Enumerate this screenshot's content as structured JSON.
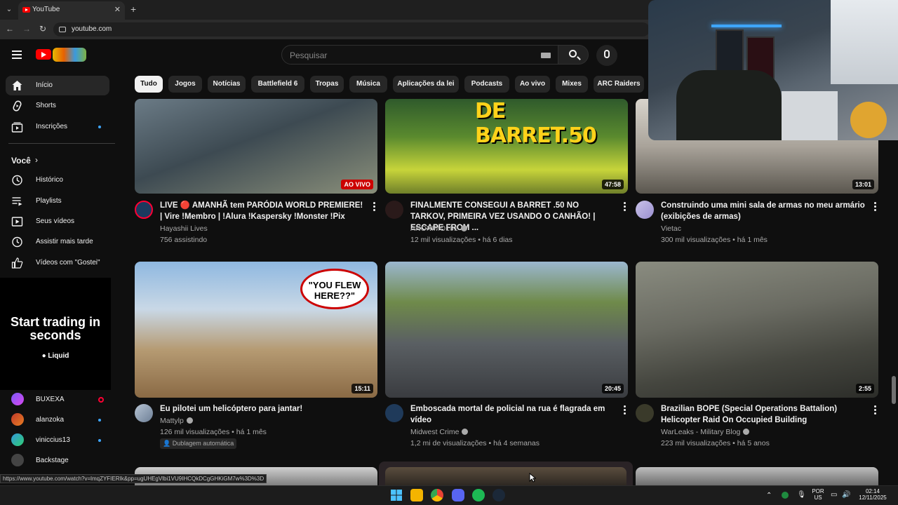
{
  "browser": {
    "tab_title": "YouTube",
    "url": "youtube.com",
    "status_url": "https://www.youtube.com/watch?v=lmqZYFIERIk&pp=ugUHEgVlbi1VU9IHCQkDCgGHKiGM7w%3D%3D"
  },
  "header": {
    "search_placeholder": "Pesquisar"
  },
  "chips": [
    {
      "label": "Tudo",
      "active": true
    },
    {
      "label": "Jogos"
    },
    {
      "label": "Notícias"
    },
    {
      "label": "Battlefield 6"
    },
    {
      "label": "Tropas"
    },
    {
      "label": "Música"
    },
    {
      "label": "Aplicações da lei"
    },
    {
      "label": "Podcasts"
    },
    {
      "label": "Ao vivo"
    },
    {
      "label": "Mixes"
    },
    {
      "label": "ARC Raiders"
    }
  ],
  "sidebar": {
    "main": [
      {
        "label": "Início",
        "icon": "home-icon"
      },
      {
        "label": "Shorts",
        "icon": "shorts-icon"
      },
      {
        "label": "Inscrições",
        "icon": "subscriptions-icon"
      }
    ],
    "you_label": "Você",
    "you_items": [
      {
        "label": "Histórico",
        "icon": "history-icon"
      },
      {
        "label": "Playlists",
        "icon": "playlists-icon"
      },
      {
        "label": "Seus vídeos",
        "icon": "your-videos-icon"
      },
      {
        "label": "Assistir mais tarde",
        "icon": "watch-later-icon"
      },
      {
        "label": "Vídeos com \"Gostei\"",
        "icon": "liked-icon"
      }
    ],
    "ad": {
      "headline": "Start trading in seconds",
      "brand": "Liquid"
    },
    "subscriptions": [
      {
        "label": "BUXEXA",
        "status": "live"
      },
      {
        "label": "alanzoka",
        "status": "new"
      },
      {
        "label": "viniccius13",
        "status": "new"
      },
      {
        "label": "Backstage",
        "status": ""
      }
    ]
  },
  "videos": [
    {
      "title": "LIVE 🔴 AMANHÃ tem PARÓDIA WORLD PREMIERE! | Vire !Membro | !Alura !Kaspersky !Monster !Pix",
      "channel": "Hayashii Lives",
      "meta": "756 assistindo",
      "badge": "AO VIVO",
      "live": true,
      "verified": false
    },
    {
      "title": "FINALMENTE CONSEGUI A BARRET .50 NO TARKOV, PRIMEIRA VEZ USANDO O CANHÃO! | ESCAPE FROM ...",
      "channel": "ANONIMO101",
      "meta": "12 mil visualizações • há 6 dias",
      "badge": "47:58",
      "thumb_text": "DE BARRET.50",
      "verified": true
    },
    {
      "title": "Construindo uma mini sala de armas no meu armário (exibições de armas)",
      "channel": "Vietac",
      "meta": "300 mil visualizações • há 1 mês",
      "badge": "13:01",
      "verified": false
    },
    {
      "title": "Eu pilotei um helicóptero para jantar!",
      "channel": "Mattylp",
      "meta": "126 mil visualizações • há 1 mês",
      "badge": "15:11",
      "thumb_text": "\"YOU FLEW HERE??\"",
      "dub": "Dublagem automática",
      "verified": true
    },
    {
      "title": "Emboscada mortal de policial na rua é flagrada em vídeo",
      "channel": "Midwest Crime",
      "meta": "1,2 mi de visualizações • há 4 semanas",
      "badge": "20:45",
      "verified": true
    },
    {
      "title": "Brazilian BOPE (Special Operations Battalion) Helicopter Raid On Occupied Building",
      "channel": "WarLeaks - Military Blog",
      "meta": "223 mil visualizações • há 5 anos",
      "badge": "2:55",
      "verified": true
    }
  ],
  "taskbar": {
    "lang_top": "POR",
    "lang_bottom": "US",
    "time": "02:14",
    "date": "12/11/2025"
  }
}
